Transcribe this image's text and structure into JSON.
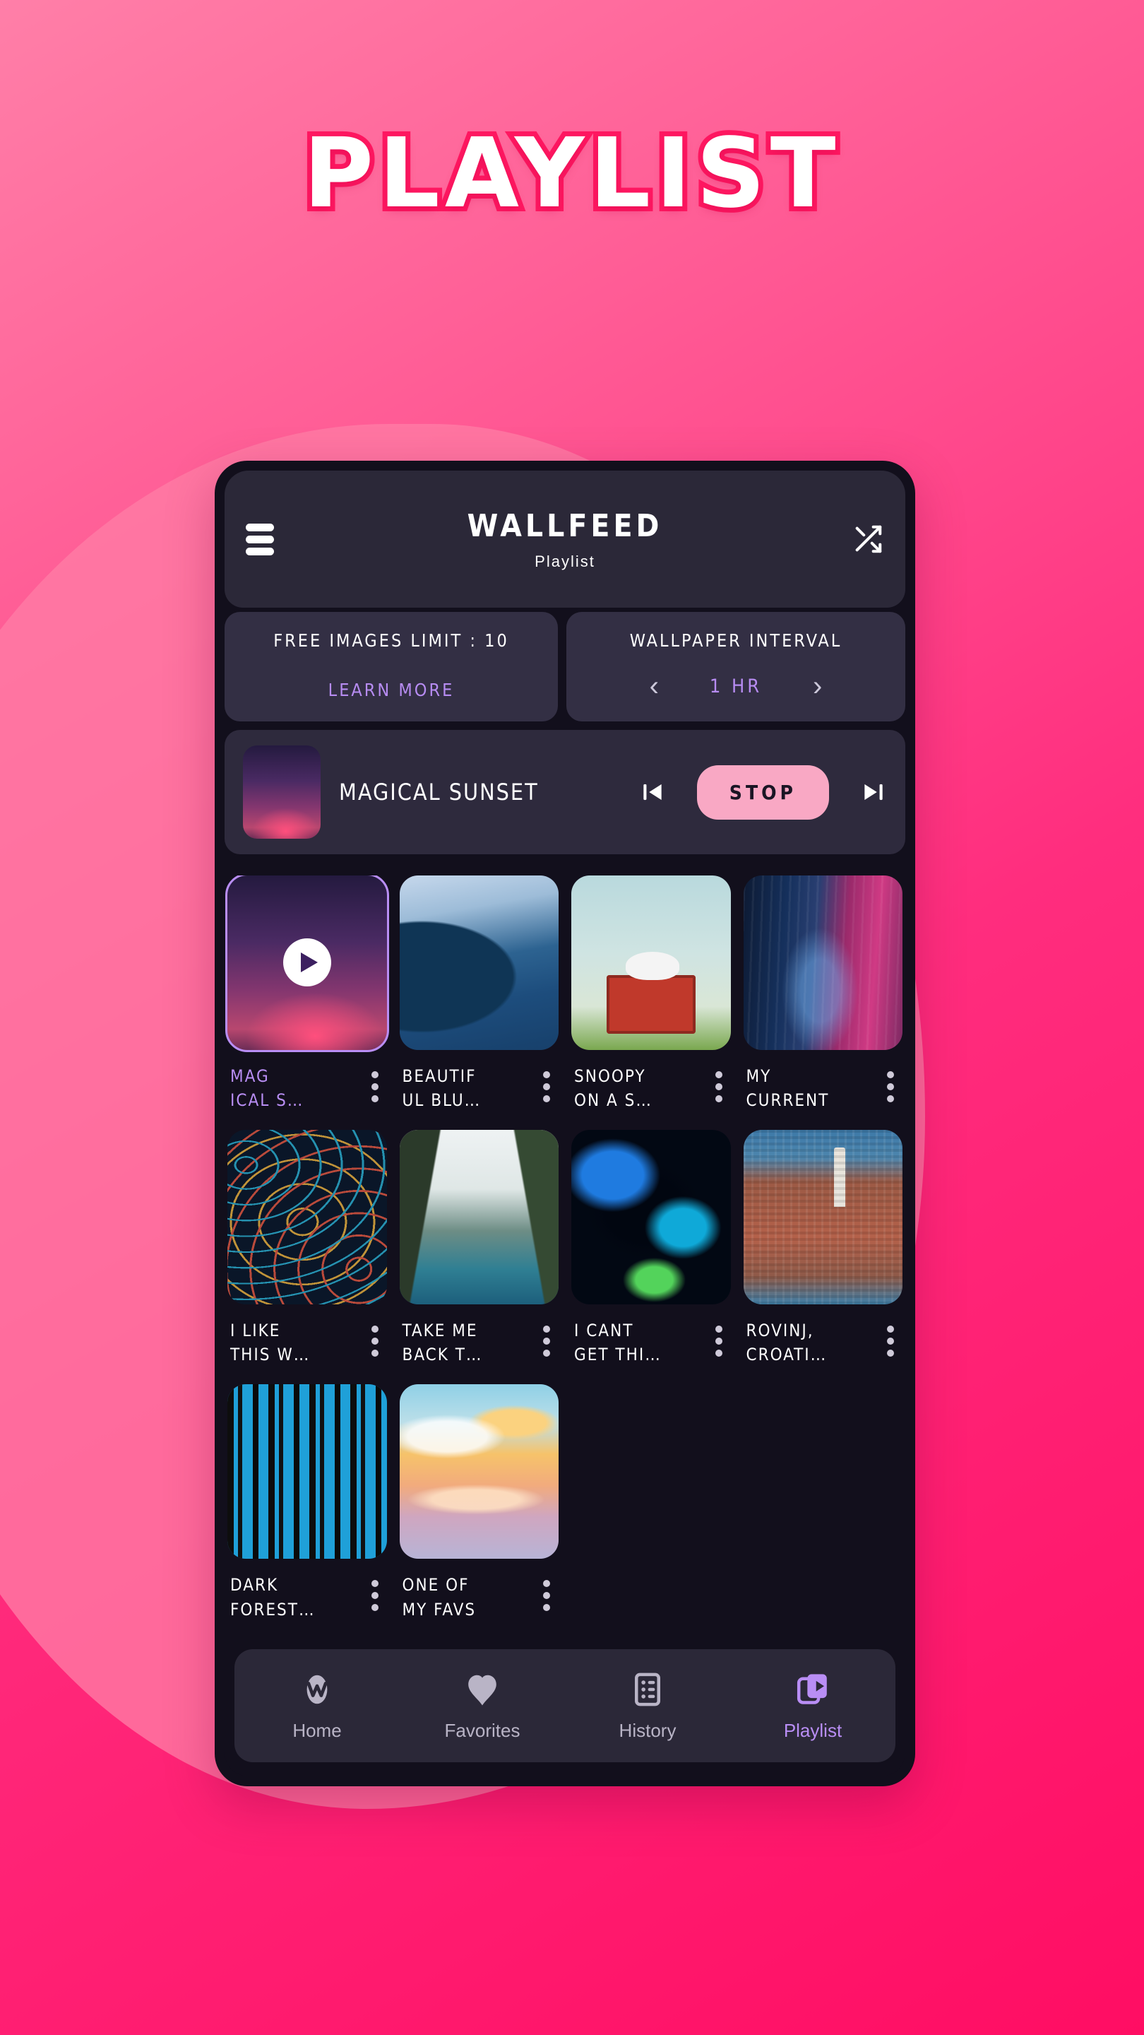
{
  "hero": {
    "title": "PLAYLIST"
  },
  "appbar": {
    "menu_icon": "hamburger-icon",
    "title": "WALLFEED",
    "subtitle": "Playlist",
    "shuffle_icon": "shuffle-icon"
  },
  "settings": {
    "free_limit": {
      "label": "FREE IMAGES LIMIT : 10",
      "action": "LEARN MORE"
    },
    "interval": {
      "label": "WALLPAPER INTERVAL",
      "prev_icon": "chevron-left-icon",
      "value": "1 HR",
      "next_icon": "chevron-right-icon"
    }
  },
  "now_playing": {
    "title": "MAGICAL SUNSET",
    "prev_icon": "skip-previous-icon",
    "stop_label": "STOP",
    "next_icon": "skip-next-icon",
    "stop_color": "#f9a8c4"
  },
  "grid": {
    "kebab_icon": "more-vertical-icon",
    "active_color": "#b98ef5",
    "items": [
      {
        "label": "MAG\nICAL S…",
        "art": "art-sunset",
        "active": true,
        "playing": true
      },
      {
        "label": "BEAUTIF\nUL BLU…",
        "art": "art-blue",
        "active": false,
        "playing": false
      },
      {
        "label": "SNOOPY\nON A S…",
        "art": "art-snoopy",
        "active": false,
        "playing": false
      },
      {
        "label": "MY\nCURRENT",
        "art": "art-city",
        "active": false,
        "playing": false
      },
      {
        "label": "I LIKE\nTHIS W…",
        "art": "art-lines",
        "active": false,
        "playing": false
      },
      {
        "label": "TAKE ME\nBACK T…",
        "art": "art-canyon",
        "active": false,
        "playing": false
      },
      {
        "label": "I CANT\nGET THI…",
        "art": "art-abyss",
        "active": false,
        "playing": false
      },
      {
        "label": "ROVINJ,\nCROATI…",
        "art": "art-rovinj",
        "active": false,
        "playing": false
      },
      {
        "label": "DARK\nFOREST…",
        "art": "art-darkforest",
        "active": false,
        "playing": false
      },
      {
        "label": "ONE OF\nMY FAVS",
        "art": "art-clouds",
        "active": false,
        "playing": false
      }
    ]
  },
  "bottom_nav": {
    "active_color": "#b98ef5",
    "items": [
      {
        "label": "Home",
        "icon": "wallfeed-logo-icon",
        "active": false
      },
      {
        "label": "Favorites",
        "icon": "heart-icon",
        "active": false
      },
      {
        "label": "History",
        "icon": "history-list-icon",
        "active": false
      },
      {
        "label": "Playlist",
        "icon": "playlist-icon",
        "active": true
      }
    ]
  },
  "theme": {
    "background_light": "#ff7fa8",
    "background_deep": "#ff0d63",
    "blob": "#ff7ca5",
    "title_stroke": "#ff1761",
    "phone_frame": "#120f1c",
    "surface": "#2b2838",
    "card": "#332f44"
  }
}
